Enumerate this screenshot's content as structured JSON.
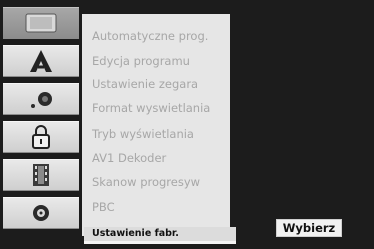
{
  "menu": {
    "items": [
      {
        "label": "Automatyczne prog."
      },
      {
        "label": "Edycja programu"
      },
      {
        "label": "Ustawienie zegara"
      },
      {
        "label": "Format wyswietlania"
      },
      {
        "label": "Tryb wyświetlania"
      },
      {
        "label": "AV1 Dekoder"
      },
      {
        "label": "Skanow progresyw"
      },
      {
        "label": "PBC"
      },
      {
        "label": "Ustawienie fabr."
      }
    ]
  },
  "buttons": {
    "select_label": "Wybierz"
  },
  "sidebar": {
    "icons": [
      "tv-screen-icon",
      "letter-a-icon",
      "speaker-icon",
      "padlock-icon",
      "film-strip-icon",
      "disc-icon"
    ]
  }
}
